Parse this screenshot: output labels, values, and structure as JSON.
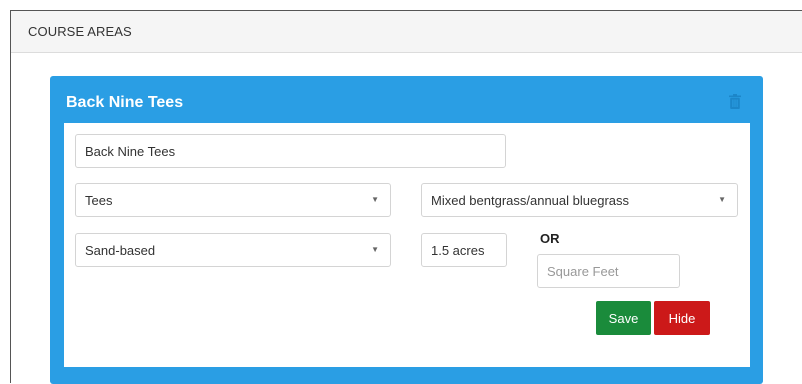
{
  "panel": {
    "title": "COURSE AREAS"
  },
  "area": {
    "title": "Back Nine Tees",
    "name_value": "Back Nine Tees",
    "area_type": "Tees",
    "grass_type": "Mixed bentgrass/annual bluegrass",
    "soil_type": "Sand-based",
    "acres_value": "1.5 acres",
    "or_label": "OR",
    "square_feet_placeholder": "Square Feet",
    "save_label": "Save",
    "hide_label": "Hide",
    "delete_icon": "trash-icon",
    "dropdown_icon": "caret-down-icon"
  },
  "colors": {
    "card_blue": "#2a9ee4",
    "save_green": "#1a8b3b",
    "hide_red": "#cc1919"
  }
}
